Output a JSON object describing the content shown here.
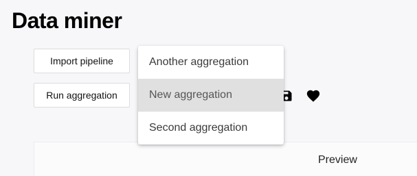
{
  "page": {
    "title": "Data miner"
  },
  "toolbar": {
    "import_label": "Import pipeline",
    "run_label": "Run aggregation",
    "save_icon": "save-icon",
    "favorite_icon": "heart-icon"
  },
  "aggregation_menu": {
    "selected_index": 1,
    "options": [
      {
        "label": "Another aggregation"
      },
      {
        "label": "New aggregation"
      },
      {
        "label": "Second aggregation"
      }
    ]
  },
  "preview": {
    "label": "Preview"
  },
  "colors": {
    "background": "#f7f7f9",
    "selected_item": "#e0e0e0",
    "text": "#111111"
  }
}
